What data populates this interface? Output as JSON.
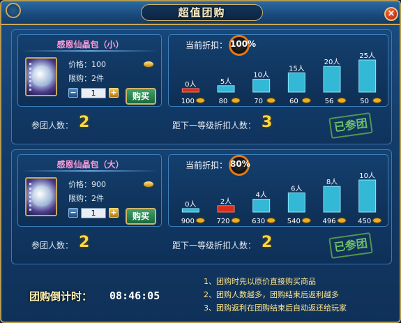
{
  "window": {
    "title": "超值团购",
    "close": "×"
  },
  "items": [
    {
      "name": "感恩仙晶包（小）",
      "price_label": "价格：100",
      "limit_label": "限购：2件",
      "quantity": "1",
      "minus": "−",
      "plus": "+",
      "buy_label": "购买",
      "join_label": "参团人数：",
      "join_value": "2",
      "discount_label": "当前折扣：",
      "discount_value": "100%",
      "next_label": "距下一等级折扣人数：",
      "next_value": "3",
      "stamp": "已参团",
      "chart_data": {
        "type": "bar",
        "categories": [
          "100",
          "80",
          "70",
          "60",
          "56",
          "50"
        ],
        "labels": [
          "0人",
          "5人",
          "10人",
          "15人",
          "20人",
          "25人"
        ],
        "values": [
          0,
          5,
          10,
          15,
          20,
          25
        ],
        "current_index": 0
      }
    },
    {
      "name": "感恩仙晶包（大）",
      "price_label": "价格：900",
      "limit_label": "限购：2件",
      "quantity": "1",
      "minus": "−",
      "plus": "+",
      "buy_label": "购买",
      "join_label": "参团人数：",
      "join_value": "2",
      "discount_label": "当前折扣：",
      "discount_value": "80%",
      "next_label": "距下一等级折扣人数：",
      "next_value": "2",
      "stamp": "已参团",
      "chart_data": {
        "type": "bar",
        "categories": [
          "900",
          "720",
          "630",
          "540",
          "496",
          "450"
        ],
        "labels": [
          "0人",
          "2人",
          "4人",
          "6人",
          "8人",
          "10人"
        ],
        "values": [
          0,
          2,
          4,
          6,
          8,
          10
        ],
        "current_index": 1
      }
    }
  ],
  "countdown": {
    "label": "团购倒计时：",
    "value": "08:46:05"
  },
  "notes": [
    "1、团购时先以原价直接购买商品",
    "2、团购人数越多，团购结束后返利越多",
    "3、团购返利在团购结束后自动返还给玩家"
  ],
  "colors": {
    "bar": "#33b8d6",
    "bar_current": "#d92c1a",
    "accent": "#ffd83a",
    "coin": "#e8b02a"
  }
}
